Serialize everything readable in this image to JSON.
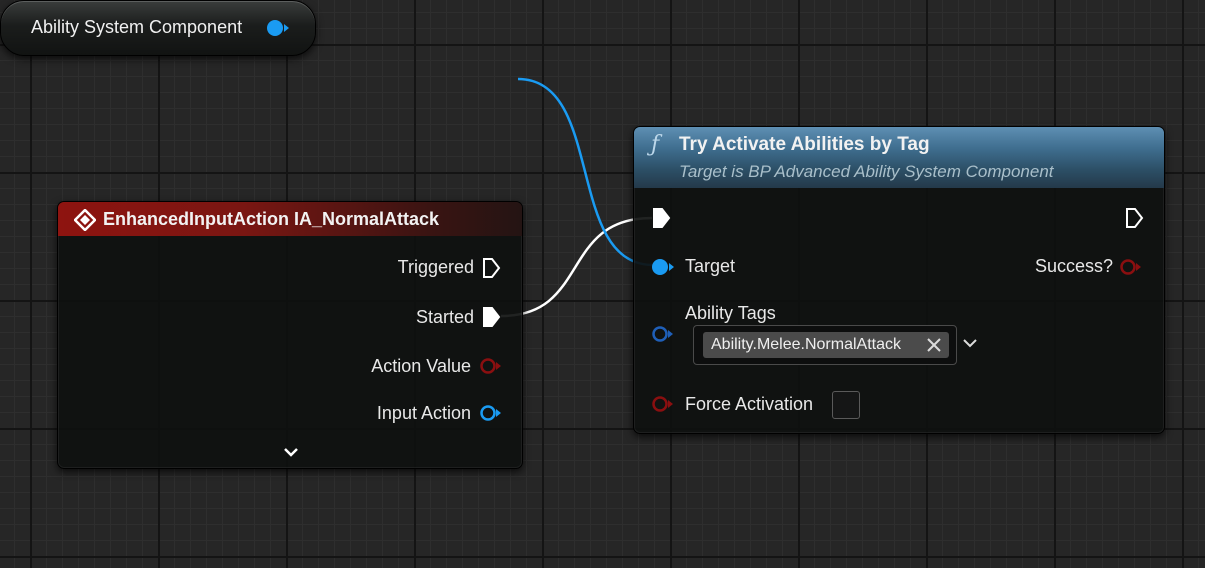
{
  "variable_node": {
    "label": "Ability System Component",
    "pin_color": "#1a9bf2"
  },
  "event_node": {
    "title": "EnhancedInputAction IA_NormalAttack",
    "header_color": "#8e1410",
    "icon": "event-diamond-icon",
    "pins": {
      "triggered": "Triggered",
      "started": "Started",
      "action_value": "Action Value",
      "input_action": "Input Action"
    },
    "expand_icon": "chevron-down-icon"
  },
  "function_node": {
    "icon": "ƒ",
    "title": "Try Activate Abilities by Tag",
    "subtitle": "Target is BP Advanced Ability System Component",
    "header_color": "#3f6e8f",
    "pins": {
      "target": "Target",
      "success": "Success?",
      "ability_tags": "Ability Tags",
      "force_activation": "Force Activation"
    },
    "ability_tags_value": "Ability.Melee.NormalAttack",
    "force_activation_checked": false
  },
  "colors": {
    "exec": "#ffffff",
    "object_pin": "#1a9bf2",
    "struct_pin": "#1f5fb8",
    "bool_pin": "#8a0f10"
  }
}
